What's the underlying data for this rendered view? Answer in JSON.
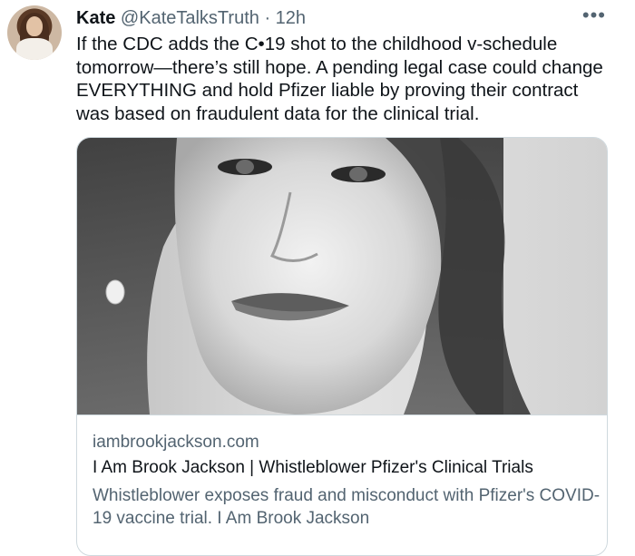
{
  "tweet": {
    "author_name": "Kate",
    "author_handle": "@KateTalksTruth",
    "separator": "·",
    "time": "12h",
    "more_label": "•••",
    "text": "If the CDC adds the C•19 shot to the childhood v-schedule tomorrow—there’s still hope. A pending legal case could change EVERYTHING and hold Pfizer liable by proving their contract was based on fraudulent data for the clinical trial."
  },
  "card": {
    "domain": "iambrookjackson.com",
    "title": "I Am Brook Jackson | Whistleblower Pfizer's Clinical Trials",
    "description": "Whistleblower exposes fraud and misconduct with Pfizer's COVID-19 vaccine trial. I Am Brook Jackson"
  },
  "colors": {
    "text_primary": "#0f1419",
    "text_secondary": "#536471",
    "border": "#cfd9de"
  },
  "icons": {
    "more": "more-horizontal-icon"
  }
}
